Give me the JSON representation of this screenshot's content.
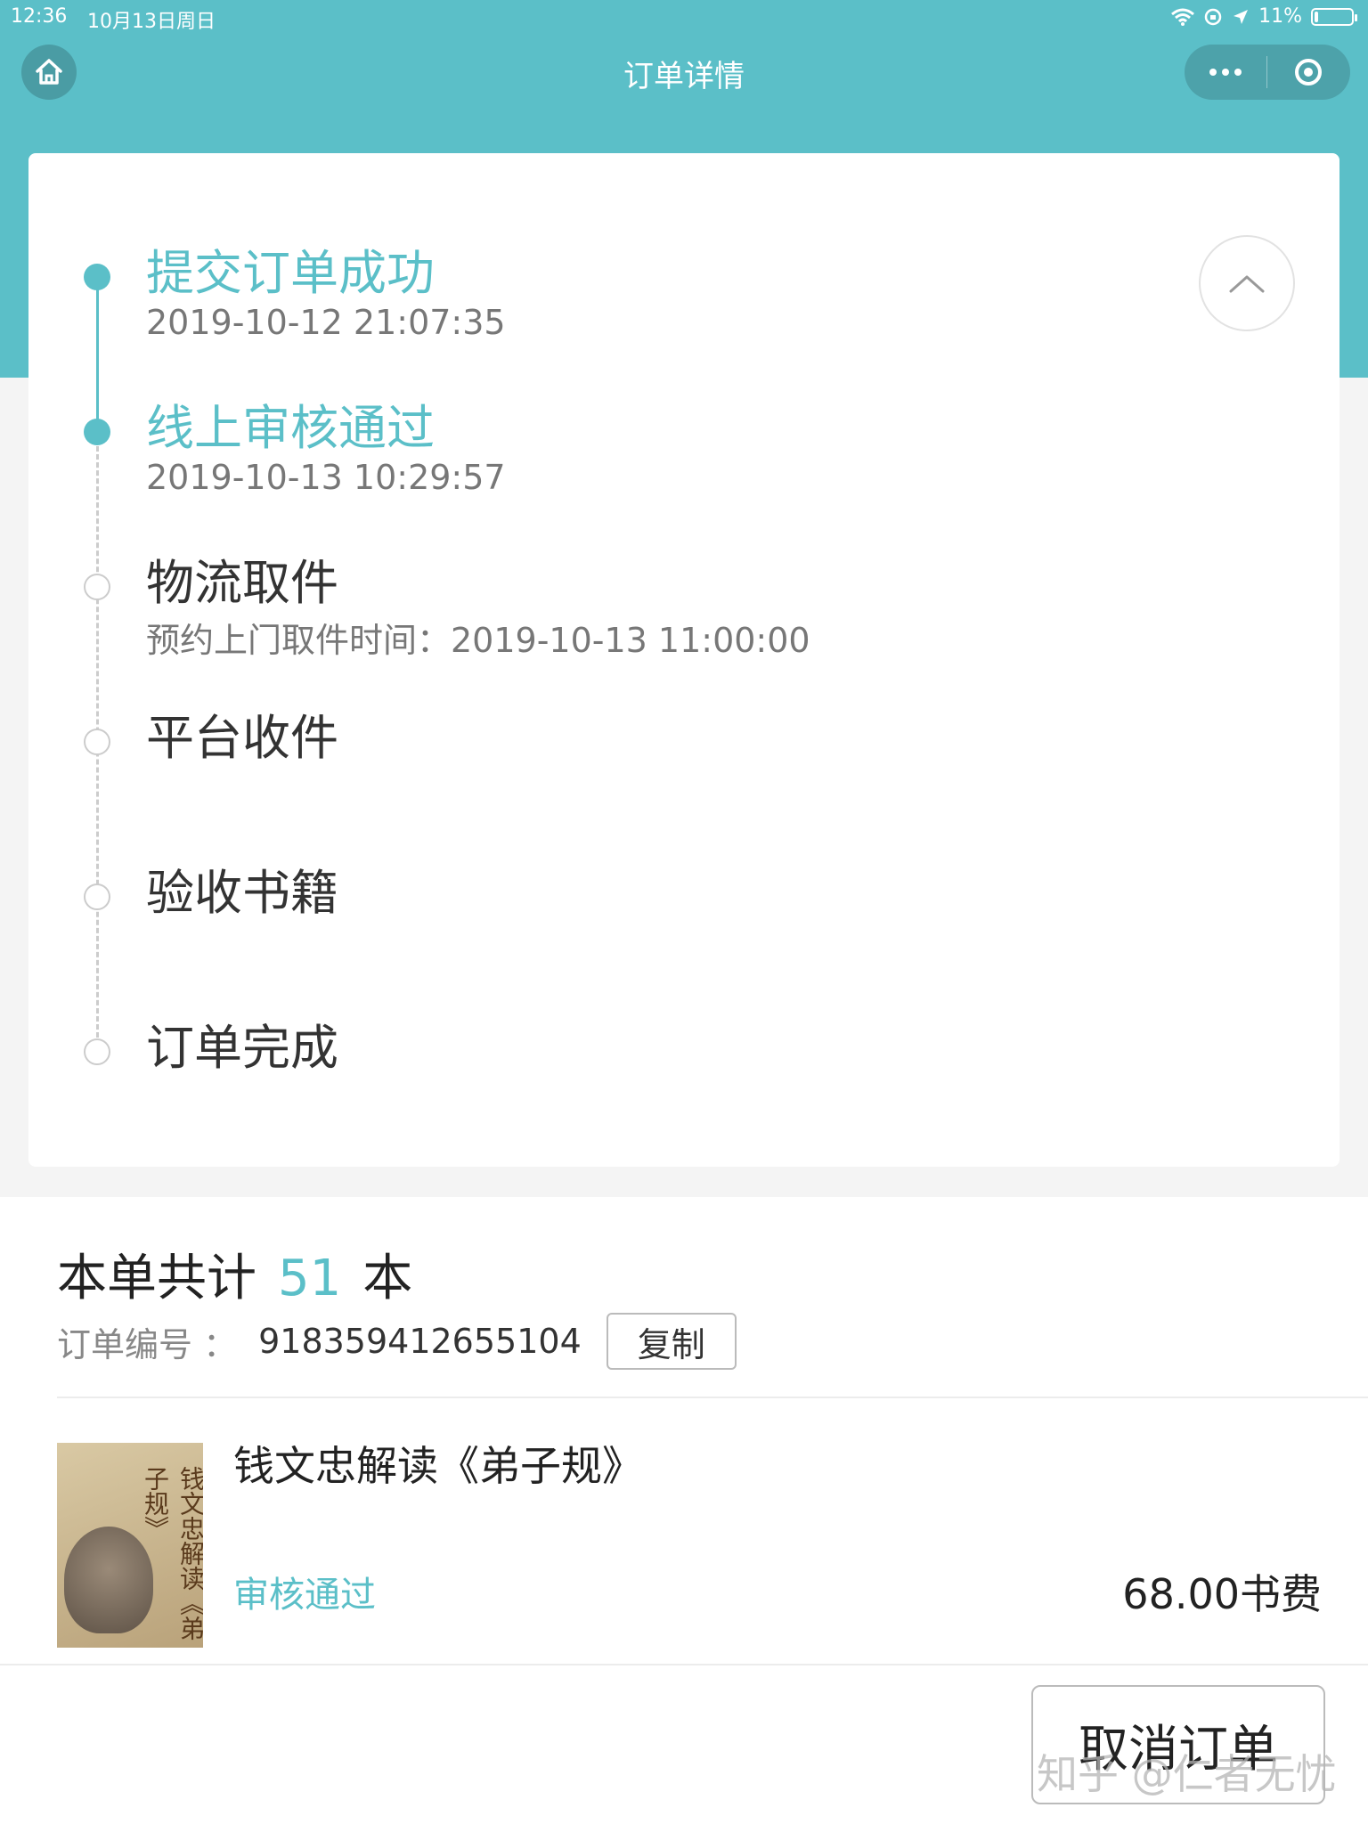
{
  "status_bar": {
    "time": "12:36",
    "date": "10月13日周日",
    "battery": "11%",
    "battery_level": 0.11
  },
  "nav": {
    "title": "订单详情",
    "home_icon": "home-icon",
    "more_icon": "more-dots-icon",
    "close_icon": "target-icon"
  },
  "colors": {
    "accent": "#5bbfc8",
    "header": "#5bbfc8"
  },
  "timeline": {
    "steps": [
      {
        "title": "提交订单成功",
        "sub": "2019-10-12  21:07:35",
        "done": true
      },
      {
        "title": "线上审核通过",
        "sub": "2019-10-13 10:29:57",
        "done": true
      },
      {
        "title": "物流取件",
        "sub": "预约上门取件时间：2019-10-13 11:00:00",
        "done": false
      },
      {
        "title": "平台收件",
        "sub": "",
        "done": false
      },
      {
        "title": "验收书籍",
        "sub": "",
        "done": false
      },
      {
        "title": "订单完成",
        "sub": "",
        "done": false
      }
    ],
    "collapse_icon": "chevron-up-icon"
  },
  "order": {
    "count_prefix": "本单共计",
    "count": "51",
    "count_unit": "本",
    "order_no_label": "订单编号 ：",
    "order_no": "918359412655104",
    "copy_label": "复制"
  },
  "book": {
    "title": "钱文忠解读《弟子规》",
    "status": "审核通过",
    "price": "68.00书费",
    "cover_text": "钱文忠解读《弟子规》"
  },
  "actions": {
    "cancel_label": "取消订单"
  },
  "watermark": "知乎 @仁者无忧"
}
